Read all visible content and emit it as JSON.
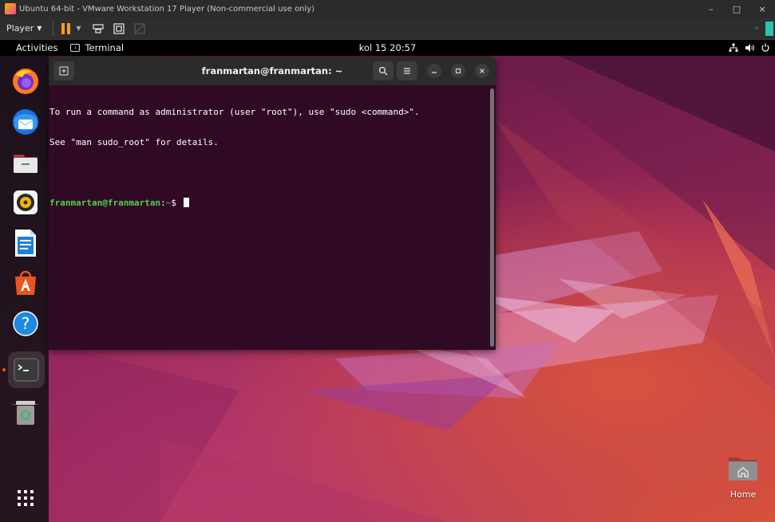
{
  "vmware": {
    "title": "Ubuntu 64-bit - VMware Workstation 17 Player (Non-commercial use only)",
    "player_menu": "Player",
    "minimize_glyph": "–",
    "maximize_glyph": "□",
    "close_glyph": "×"
  },
  "gnome": {
    "activities": "Activities",
    "app_name": "Terminal",
    "clock": "kol 15  20:57",
    "tray": [
      "network-icon",
      "volume-icon",
      "power-icon"
    ]
  },
  "dock": {
    "items": [
      {
        "name": "firefox",
        "icon": "firefox-icon"
      },
      {
        "name": "thunderbird",
        "icon": "thunderbird-icon"
      },
      {
        "name": "files",
        "icon": "files-icon"
      },
      {
        "name": "rhythmbox",
        "icon": "rhythmbox-icon"
      },
      {
        "name": "libreoffice-writer",
        "icon": "writer-icon"
      },
      {
        "name": "app-center",
        "icon": "app-center-icon"
      },
      {
        "name": "help",
        "icon": "help-icon"
      },
      {
        "name": "terminal",
        "icon": "terminal-icon",
        "running": true
      },
      {
        "name": "trash",
        "icon": "trash-icon"
      },
      {
        "name": "show-apps",
        "icon": "app-grid-icon"
      }
    ]
  },
  "terminal": {
    "title": "franmartan@franmartan: ~",
    "lines": [
      "To run a command as administrator (user \"root\"), use \"sudo <command>\".",
      "See \"man sudo_root\" for details."
    ],
    "prompt_user": "franmartan@franmartan",
    "prompt_sep": ":",
    "prompt_path": "~",
    "prompt_symbol": "$",
    "colors": {
      "background": "#300a24",
      "prompt_user": "#4fd14f",
      "prompt_path": "#5b7fe0"
    }
  },
  "desktop": {
    "home_label": "Home"
  }
}
